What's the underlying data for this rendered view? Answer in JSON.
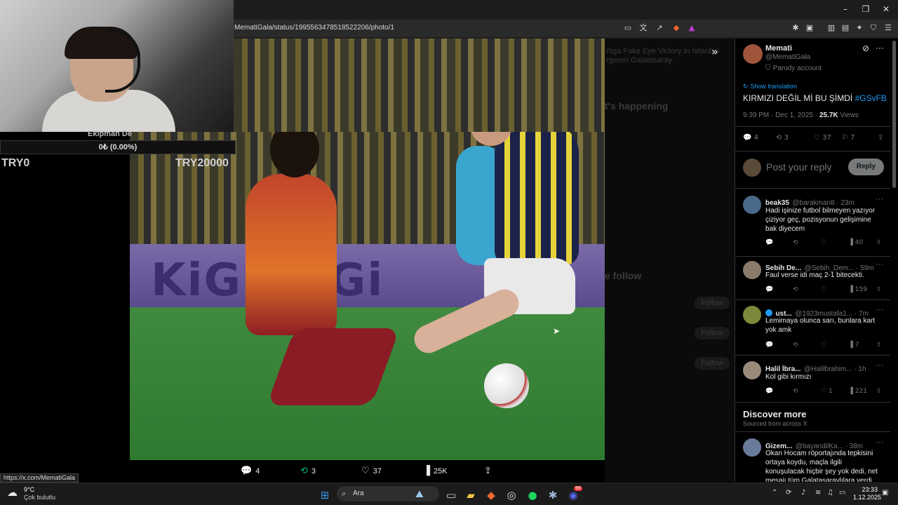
{
  "browser": {
    "url": "MematiGala/status/1995563478518522206/photo/1",
    "status_url": "https://x.com/MematiGala"
  },
  "overlay": {
    "label": "Ekipman De",
    "bar_text": "0₺ (0.00%)",
    "left_tag": "TRY0",
    "right_tag": "TRY20000"
  },
  "photo": {
    "ad_text": "KiGi  KiGi",
    "actions": {
      "replies": "4",
      "reposts": "3",
      "likes": "37",
      "views": "25K"
    }
  },
  "dimmed_page": {
    "lines": [
      "rtiga Fake Eye Victory In Istanbul",
      "rgeron Galatasaray",
      "t's happening",
      "e follow",
      "Follow",
      "Follow",
      "Follow"
    ]
  },
  "tweet": {
    "author_name": "Memati",
    "author_handle": "@MematiGala",
    "parody_label": "Parody account",
    "show_translation": "Show translation",
    "text": "KIRMIZI DEĞİL Mİ BU ŞİMDİ",
    "hashtag": "#GSvFB",
    "time": "9:39 PM · Dec 1, 2025 · ",
    "views_count": "25.7K",
    "views_label": " Views",
    "stats": {
      "replies": "4",
      "reposts": "3",
      "likes": "37",
      "bookmarks": "7"
    },
    "reply_placeholder": "Post your reply",
    "reply_button": "Reply"
  },
  "replies": [
    {
      "name": "beak35",
      "handle": "@barakman8 · 23m",
      "text": "Hadi işinize futbol bilmeyen yazıyor çiziyor geç,  pozisyonun  gelişimine bak diyecem",
      "likes": "",
      "views": "40",
      "avatar_color": "#4a6a8a"
    },
    {
      "name": "Sebih De...",
      "handle": "@Sebih_Dem... · 59m",
      "text": "Faul verse idi maç 2-1 bitecekti.",
      "likes": "",
      "views": "159",
      "avatar_color": "#8a7a6a"
    },
    {
      "name": "ust...",
      "handle": "@1923mustafa1... · 7m",
      "text": "Lemimaya olunca sarı, bunlara kart yok amk",
      "likes": "",
      "views": "7",
      "avatar_color": "#7a8a3a"
    },
    {
      "name": "Halil İbra...",
      "handle": "@Halilbrahim... · 1h",
      "text": "Kol gibi kırmızı",
      "likes": "1",
      "views": "221",
      "avatar_color": "#9a8a7a"
    }
  ],
  "discover": {
    "title": "Discover more",
    "subtitle": "Sourced from across X",
    "item": {
      "name": "Gizem...",
      "handle": "@bayandilKa... · 38m",
      "text": "Okan Hocam röportajında tepkisini ortaya koydu, maçla ilgili konuşulacak hiçbir şey yok dedi, net mesajı tüm Galatasaraylılara verdi"
    }
  },
  "taskbar": {
    "weather_temp": "9°C",
    "weather_desc": "Çok bulutlu",
    "search_label": "Ara",
    "time": "23:33",
    "date": "1.12.2025",
    "discord_badge": "99"
  },
  "colors": {
    "accent": "#1d9bf0",
    "background": "#000000"
  }
}
